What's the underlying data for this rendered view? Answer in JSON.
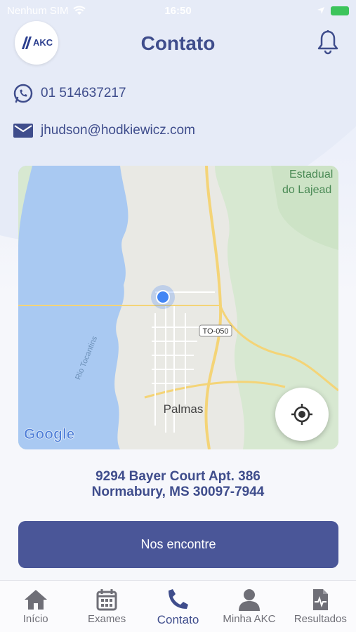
{
  "status_bar": {
    "carrier": "Nenhum SIM",
    "time": "16:50"
  },
  "header": {
    "title": "Contato",
    "logo_text": "AKC"
  },
  "contact": {
    "phone": "01 514637217",
    "email": "jhudson@hodkiewicz.com"
  },
  "map": {
    "labels": {
      "park_line1": "Estadual",
      "park_line2": "do Lajead",
      "city": "Palmas",
      "road": "TO-050",
      "river": "Rio Tocantins",
      "google": "Google"
    }
  },
  "address": {
    "line1": "9294 Bayer Court Apt. 386",
    "line2": "Normabury, MS 30097-7944"
  },
  "cta": {
    "label": "Nos encontre"
  },
  "tabs": [
    {
      "label": "Início",
      "icon": "home-icon"
    },
    {
      "label": "Exames",
      "icon": "calendar-icon"
    },
    {
      "label": "Contato",
      "icon": "phone-icon"
    },
    {
      "label": "Minha AKC",
      "icon": "person-icon"
    },
    {
      "label": "Resultados",
      "icon": "results-icon"
    }
  ],
  "colors": {
    "accent": "#3f4d8c",
    "button": "#4a5698",
    "water": "#a9c9f2"
  }
}
